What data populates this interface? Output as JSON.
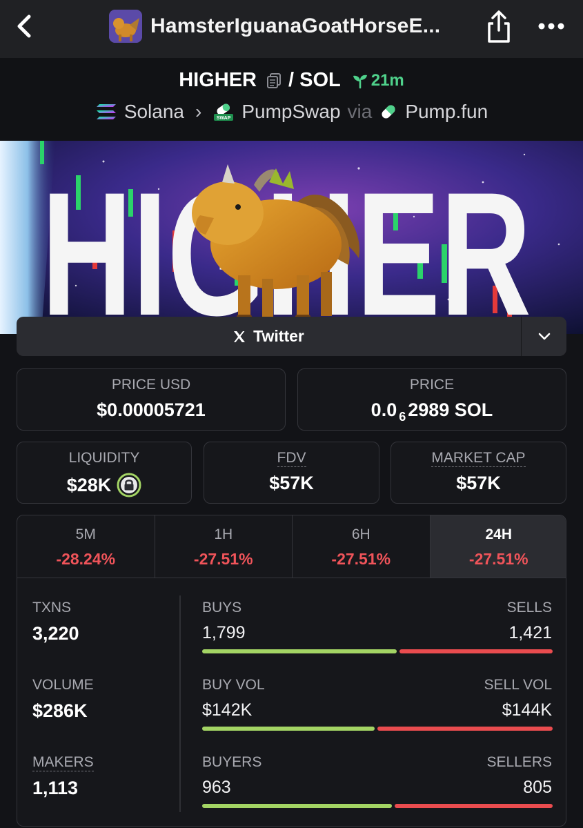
{
  "nav": {
    "title": "HamsterIguanaGoatHorseE...",
    "back_icon": "chevron-left-icon",
    "share_icon": "share-icon",
    "more_icon": "more-icon"
  },
  "pair": {
    "base": "HIGHER",
    "quote": "/ SOL",
    "age": "21m",
    "chain": "Solana",
    "dex": "PumpSwap",
    "via": "via",
    "launchpad": "Pump.fun"
  },
  "social": {
    "twitter_label": "Twitter"
  },
  "price": {
    "usd_label": "PRICE USD",
    "usd_value": "$0.00005721",
    "native_label": "PRICE",
    "native_prefix": "0.0",
    "native_sub": "6",
    "native_rest": "2989 SOL"
  },
  "metrics": {
    "liquidity_label": "LIQUIDITY",
    "liquidity_value": "$28K",
    "fdv_label": "FDV",
    "fdv_value": "$57K",
    "mcap_label": "MARKET CAP",
    "mcap_value": "$57K"
  },
  "timeframes": [
    {
      "label": "5M",
      "change": "-28.24%"
    },
    {
      "label": "1H",
      "change": "-27.51%"
    },
    {
      "label": "6H",
      "change": "-27.51%"
    },
    {
      "label": "24H",
      "change": "-27.51%"
    }
  ],
  "stats": {
    "txns_label": "TXNS",
    "txns_value": "3,220",
    "volume_label": "VOLUME",
    "volume_value": "$286K",
    "makers_label": "MAKERS",
    "makers_value": "1,113",
    "buys_label": "BUYS",
    "buys_value": "1,799",
    "sells_label": "SELLS",
    "sells_value": "1,421",
    "buys_ratio": 0.5587,
    "buyvol_label": "BUY VOL",
    "buyvol_value": "$142K",
    "sellvol_label": "SELL VOL",
    "sellvol_value": "$144K",
    "buyvol_ratio": 0.4965,
    "buyers_label": "BUYERS",
    "buyers_value": "963",
    "sellers_label": "SELLERS",
    "sellers_value": "805",
    "buyers_ratio": 0.5447
  },
  "banner": {
    "text": "HIGHER"
  },
  "colors": {
    "up": "#a3d464",
    "down": "#ea4c4f",
    "accent_green": "#4fd18b"
  }
}
